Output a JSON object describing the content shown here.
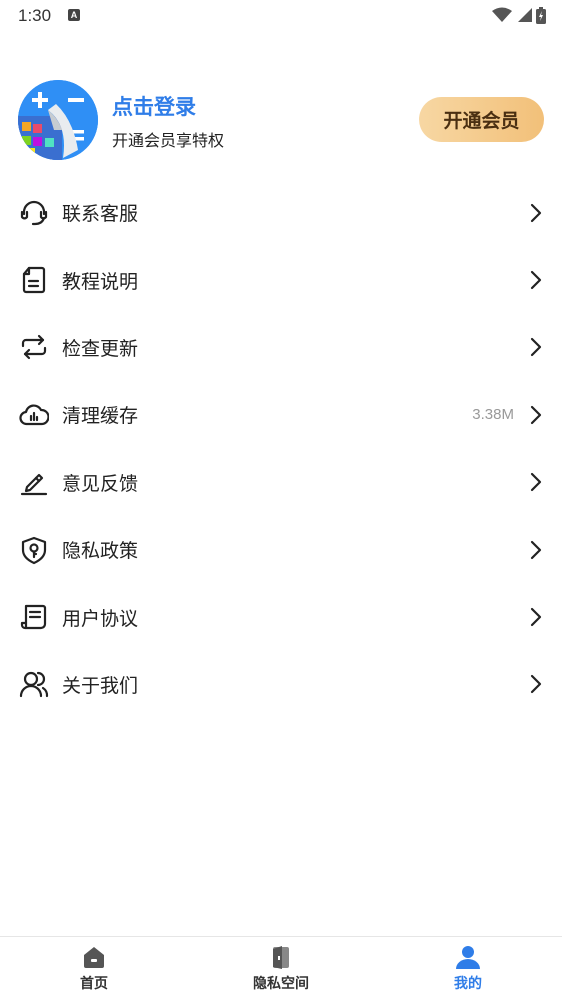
{
  "status_bar": {
    "time": "1:30",
    "notification_icon": "A"
  },
  "profile": {
    "login_label": "点击登录",
    "subtitle": "开通会员享特权",
    "vip_button": "开通会员"
  },
  "menu": {
    "items": [
      {
        "label": "联系客服",
        "icon": "headset-icon",
        "value": ""
      },
      {
        "label": "教程说明",
        "icon": "document-icon",
        "value": ""
      },
      {
        "label": "检查更新",
        "icon": "refresh-icon",
        "value": ""
      },
      {
        "label": "清理缓存",
        "icon": "cloud-icon",
        "value": "3.38M"
      },
      {
        "label": "意见反馈",
        "icon": "pen-icon",
        "value": ""
      },
      {
        "label": "隐私政策",
        "icon": "shield-icon",
        "value": ""
      },
      {
        "label": "用户协议",
        "icon": "agreement-icon",
        "value": ""
      },
      {
        "label": "关于我们",
        "icon": "users-icon",
        "value": ""
      }
    ]
  },
  "tabbar": {
    "tabs": [
      {
        "label": "首页",
        "icon": "home-icon",
        "active": false
      },
      {
        "label": "隐私空间",
        "icon": "private-space-icon",
        "active": false
      },
      {
        "label": "我的",
        "icon": "user-icon",
        "active": true
      }
    ]
  },
  "colors": {
    "accent": "#2f7de8",
    "vip_gold": "#f2c079",
    "text": "#222222"
  }
}
